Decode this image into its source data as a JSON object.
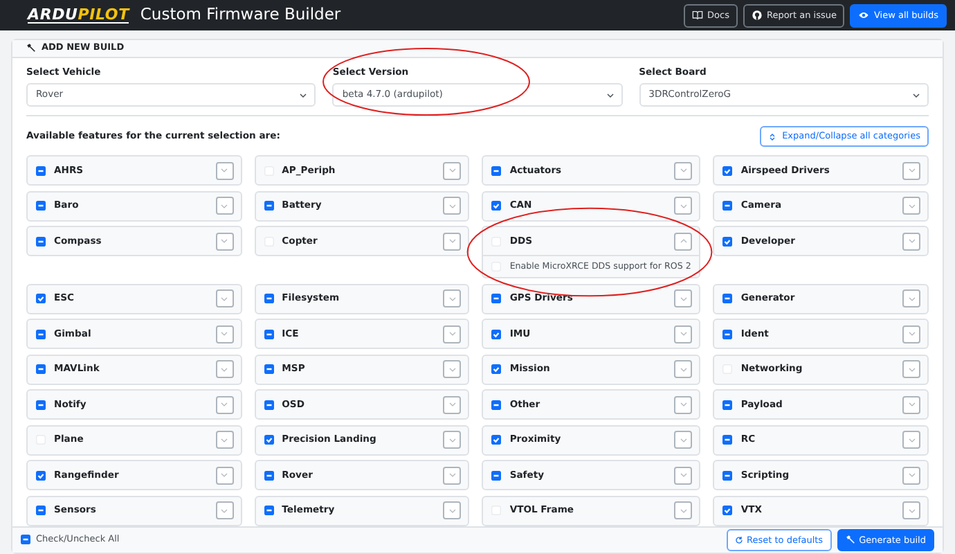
{
  "navbar": {
    "logo_parts": [
      {
        "text": "ARDU",
        "color": "#ffffff"
      },
      {
        "text": "PILOT",
        "color": "#f4c20d"
      }
    ],
    "title": "Custom Firmware Builder",
    "buttons": [
      {
        "label": "Docs",
        "kind": "docs"
      },
      {
        "label": "Report an issue",
        "kind": "issue"
      },
      {
        "label": "View all builds",
        "kind": "builds"
      }
    ]
  },
  "build_card": {
    "header": "ADD NEW BUILD",
    "selects": [
      {
        "label": "Select Vehicle",
        "value": "Rover",
        "circled": false
      },
      {
        "label": "Select Version",
        "value": "beta 4.7.0 (ardupilot)",
        "circled": true
      },
      {
        "label": "Select Board",
        "value": "3DRControlZeroG",
        "circled": false
      }
    ],
    "features_label": "Available features for the current selection are:",
    "expand_all_button": "Expand/Collapse all categories",
    "categories": [
      {
        "name": "AHRS",
        "checked": false,
        "partial": true,
        "expanded": false
      },
      {
        "name": "AP_Periph",
        "checked": false,
        "partial": false,
        "expanded": false
      },
      {
        "name": "Actuators",
        "checked": false,
        "partial": true,
        "expanded": false
      },
      {
        "name": "Airspeed Drivers",
        "checked": true,
        "partial": false,
        "expanded": false
      },
      {
        "name": "Baro",
        "checked": false,
        "partial": true,
        "expanded": false
      },
      {
        "name": "Battery",
        "checked": false,
        "partial": true,
        "expanded": false
      },
      {
        "name": "CAN",
        "checked": true,
        "partial": false,
        "expanded": false
      },
      {
        "name": "Camera",
        "checked": false,
        "partial": true,
        "expanded": false
      },
      {
        "name": "Compass",
        "checked": false,
        "partial": true,
        "expanded": false
      },
      {
        "name": "Copter",
        "checked": false,
        "partial": false,
        "expanded": false
      },
      {
        "name": "DDS",
        "checked": false,
        "partial": false,
        "expanded": true,
        "circled": true,
        "options": [
          {
            "label": "Enable MicroXRCE DDS support for ROS 2",
            "checked": false
          }
        ]
      },
      {
        "name": "Developer",
        "checked": true,
        "partial": false,
        "expanded": false
      },
      {
        "name": "ESC",
        "checked": true,
        "partial": false,
        "expanded": false
      },
      {
        "name": "Filesystem",
        "checked": false,
        "partial": true,
        "expanded": false
      },
      {
        "name": "GPS Drivers",
        "checked": false,
        "partial": true,
        "expanded": false
      },
      {
        "name": "Generator",
        "checked": false,
        "partial": true,
        "expanded": false
      },
      {
        "name": "Gimbal",
        "checked": false,
        "partial": true,
        "expanded": false
      },
      {
        "name": "ICE",
        "checked": false,
        "partial": true,
        "expanded": false
      },
      {
        "name": "IMU",
        "checked": true,
        "partial": false,
        "expanded": false
      },
      {
        "name": "Ident",
        "checked": false,
        "partial": true,
        "expanded": false
      },
      {
        "name": "MAVLink",
        "checked": false,
        "partial": true,
        "expanded": false
      },
      {
        "name": "MSP",
        "checked": false,
        "partial": true,
        "expanded": false
      },
      {
        "name": "Mission",
        "checked": true,
        "partial": false,
        "expanded": false
      },
      {
        "name": "Networking",
        "checked": false,
        "partial": false,
        "expanded": false
      },
      {
        "name": "Notify",
        "checked": false,
        "partial": true,
        "expanded": false
      },
      {
        "name": "OSD",
        "checked": false,
        "partial": true,
        "expanded": false
      },
      {
        "name": "Other",
        "checked": false,
        "partial": true,
        "expanded": false
      },
      {
        "name": "Payload",
        "checked": false,
        "partial": true,
        "expanded": false
      },
      {
        "name": "Plane",
        "checked": false,
        "partial": false,
        "expanded": false
      },
      {
        "name": "Precision Landing",
        "checked": true,
        "partial": false,
        "expanded": false
      },
      {
        "name": "Proximity",
        "checked": true,
        "partial": false,
        "expanded": false
      },
      {
        "name": "RC",
        "checked": false,
        "partial": true,
        "expanded": false
      },
      {
        "name": "Rangefinder",
        "checked": true,
        "partial": false,
        "expanded": false
      },
      {
        "name": "Rover",
        "checked": false,
        "partial": true,
        "expanded": false
      },
      {
        "name": "Safety",
        "checked": false,
        "partial": true,
        "expanded": false
      },
      {
        "name": "Scripting",
        "checked": false,
        "partial": true,
        "expanded": false
      },
      {
        "name": "Sensors",
        "checked": false,
        "partial": true,
        "expanded": false
      },
      {
        "name": "Telemetry",
        "checked": false,
        "partial": true,
        "expanded": false
      },
      {
        "name": "VTOL Frame",
        "checked": false,
        "partial": false,
        "expanded": false
      },
      {
        "name": "VTX",
        "checked": true,
        "partial": false,
        "expanded": false
      }
    ],
    "footer": {
      "check_all": {
        "label": "Check/Uncheck All",
        "checked": false,
        "partial": true
      },
      "reset_button": "Reset to defaults",
      "generate_button": "Generate build"
    }
  }
}
